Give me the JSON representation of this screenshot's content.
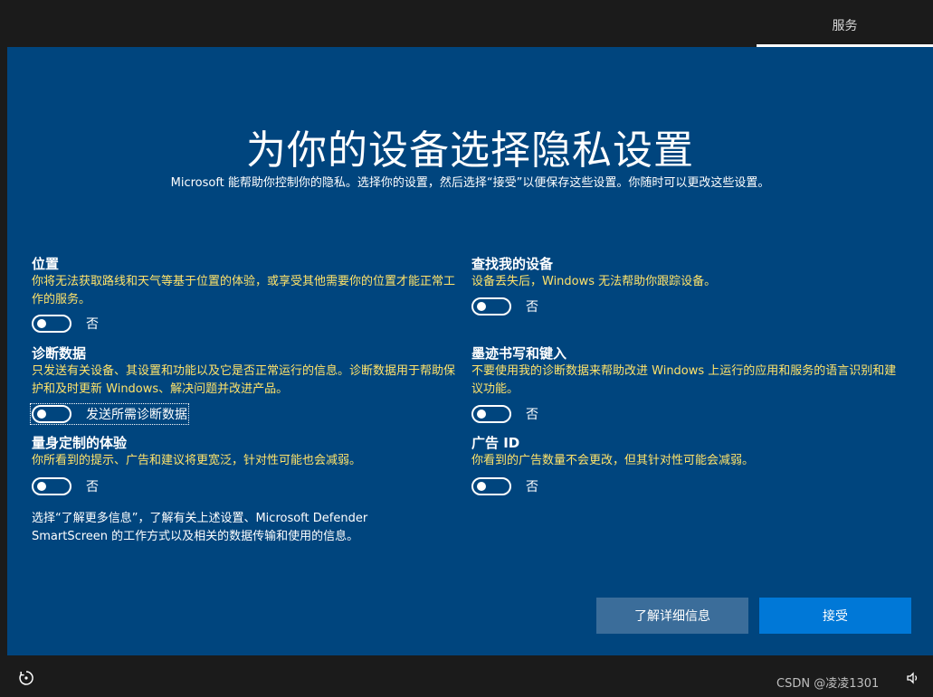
{
  "header": {
    "tab_label": "服务"
  },
  "main": {
    "title": "为你的设备选择隐私设置",
    "subtitle": "Microsoft 能帮助你控制你的隐私。选择你的设置，然后选择“接受”以便保存这些设置。你随时可以更改这些设置。"
  },
  "settings": {
    "location": {
      "title": "位置",
      "desc": "你将无法获取路线和天气等基于位置的体验，或享受其他需要你的位置才能正常工作的服务。",
      "toggle_label": "否",
      "toggle_on": false
    },
    "find_device": {
      "title": "查找我的设备",
      "desc": "设备丢失后，Windows 无法帮助你跟踪设备。",
      "toggle_label": "否",
      "toggle_on": false
    },
    "diagnostics": {
      "title": "诊断数据",
      "desc": "只发送有关设备、其设置和功能以及它是否正常运行的信息。诊断数据用于帮助保护和及时更新 Windows、解决问题并改进产品。",
      "toggle_label": "发送所需诊断数据",
      "toggle_on": false
    },
    "inking": {
      "title": "墨迹书写和键入",
      "desc": "不要使用我的诊断数据来帮助改进 Windows 上运行的应用和服务的语言识别和建议功能。",
      "toggle_label": "否",
      "toggle_on": false
    },
    "tailored": {
      "title": "量身定制的体验",
      "desc": "你所看到的提示、广告和建议将更宽泛，针对性可能也会减弱。",
      "toggle_label": "否",
      "toggle_on": false
    },
    "ad_id": {
      "title": "广告 ID",
      "desc": "你看到的广告数量不会更改，但其针对性可能会减弱。",
      "toggle_label": "否",
      "toggle_on": false
    }
  },
  "note": "选择“了解更多信息”，了解有关上述设置、Microsoft Defender SmartScreen 的工作方式以及相关的数据传输和使用的信息。",
  "buttons": {
    "learn_more": "了解详细信息",
    "accept": "接受"
  },
  "footer": {
    "watermark": "CSDN @凌凌1301"
  },
  "colors": {
    "panel": "#00457e",
    "desc_text": "#ffe36a",
    "primary_button": "#0078d7",
    "secondary_button": "#3b6d9a"
  }
}
